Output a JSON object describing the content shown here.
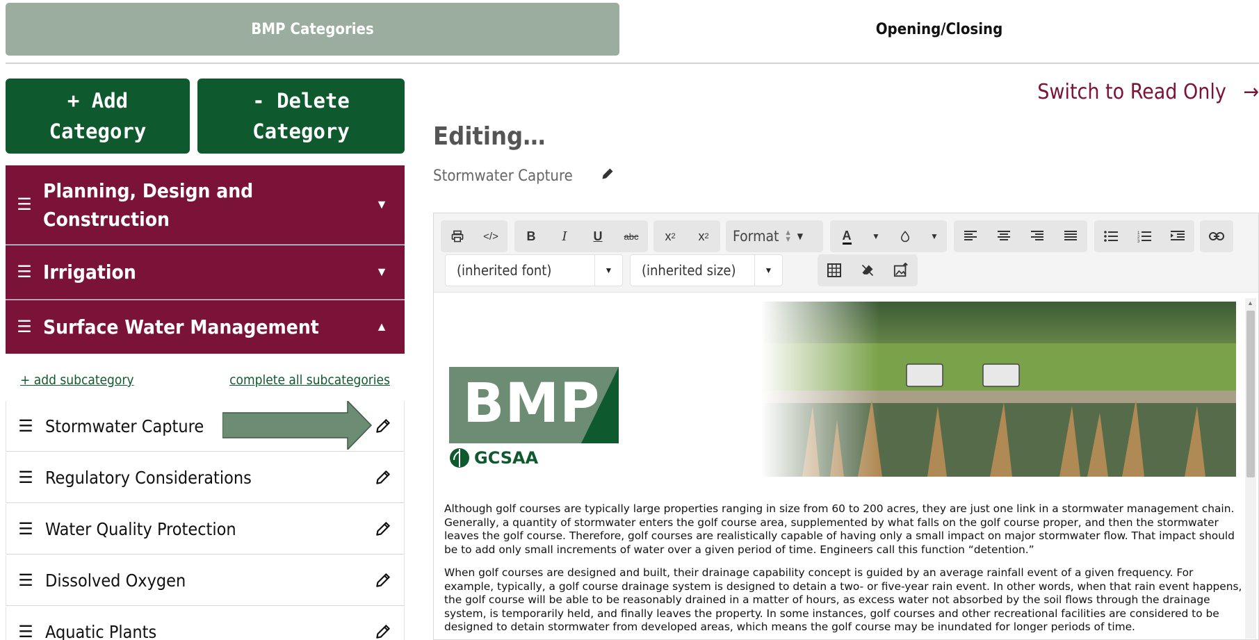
{
  "tabs": [
    {
      "label": "BMP Categories"
    },
    {
      "label": "Opening/Closing"
    }
  ],
  "sidebar": {
    "add_button": {
      "line1": "+ Add",
      "line2": "Category"
    },
    "delete_button": {
      "line1": "- Delete",
      "line2": "Category"
    },
    "categories": [
      {
        "line1": "Planning, Design and",
        "line2": "Construction",
        "expanded": false
      },
      {
        "label": "Irrigation",
        "expanded": false
      },
      {
        "label": "Surface Water Management",
        "expanded": true
      }
    ],
    "add_subcategory_link": "+ add subcategory",
    "complete_all_link": "complete all subcategories",
    "subcategories": [
      {
        "label": "Stormwater Capture"
      },
      {
        "label": "Regulatory Considerations"
      },
      {
        "label": "Water Quality Protection"
      },
      {
        "label": "Dissolved Oxygen"
      },
      {
        "label": "Aquatic Plants"
      }
    ]
  },
  "main": {
    "switch_link": "Switch to Read Only",
    "switch_arrow": "→",
    "editing_heading": "Editing…",
    "title": "Stormwater Capture"
  },
  "editor": {
    "format_label": "Format",
    "font_select": "(inherited font)",
    "size_select": "(inherited size)",
    "icons": [
      "print-icon",
      "code-icon",
      "bold-icon",
      "italic-icon",
      "underline-icon",
      "strikethrough-icon",
      "subscript-icon",
      "superscript-icon",
      "text-color-icon",
      "highlight-icon",
      "align-left-icon",
      "align-center-icon",
      "align-right-icon",
      "justify-icon",
      "bulleted-list-icon",
      "numbered-list-icon",
      "indent-icon",
      "link-icon",
      "table-icon",
      "clear-format-icon",
      "insert-image-icon"
    ],
    "logo_text": "BMP",
    "gcsaa_text": "GCSAA",
    "paragraph1": "Although golf courses are typically large properties ranging in size from 60 to 200 acres, they are just one link in a stormwater management chain. Generally, a quantity of stormwater enters the golf course area, supplemented by what falls on the golf course proper, and then the stormwater leaves the golf course. Therefore, golf courses are realistically capable of having only a small impact on major stormwater flow. That impact should be to add only small increments of water over a given period of time. Engineers call this function “detention.”",
    "paragraph2": "When golf courses are designed and built, their drainage capability concept is guided by an average rainfall event of a given frequency. For example, typically, a golf course drainage system is designed to detain a two- or five-year rain event. In other words, when that rain event happens, the golf course will be able to be reasonably drained in a matter of hours, as excess water not absorbed by the soil flows through the drainage system, is temporarily held, and finally leaves the property. In some instances, golf courses and other recreational facilities are considered to be designed to detain stormwater from developed areas, which means the golf course may be inundated for longer periods of time."
  },
  "colors": {
    "brand_green": "#0e5a2e",
    "maroon": "#7b1238",
    "tab_active": "#9aad9f",
    "arrow_green": "#6d8c74"
  }
}
